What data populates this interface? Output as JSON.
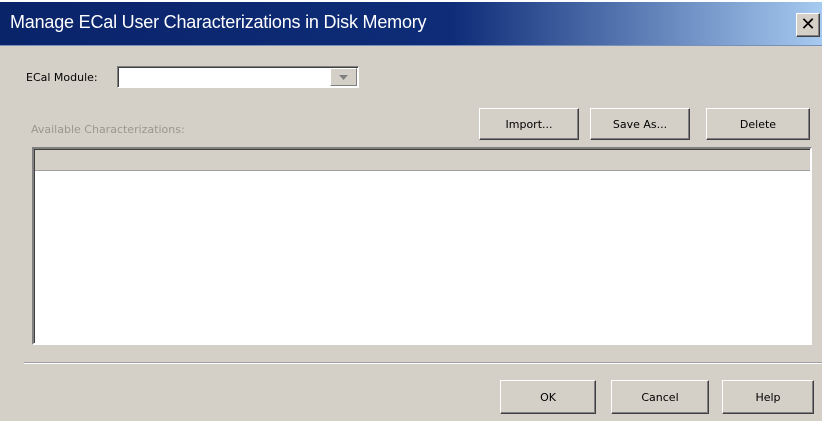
{
  "dialog": {
    "title": "Manage ECal User Characterizations in Disk Memory",
    "close_glyph": "✕"
  },
  "module": {
    "label": "ECal Module:",
    "selected": ""
  },
  "characterizations": {
    "label": "Available Characterizations:",
    "items": []
  },
  "actions": {
    "import": "Import...",
    "save_as": "Save As...",
    "delete": "Delete"
  },
  "footer": {
    "ok": "OK",
    "cancel": "Cancel",
    "help": "Help"
  },
  "icons": {
    "close": "close-icon",
    "dropdown": "chevron-down-icon"
  },
  "colors": {
    "titlebar": "#0a246a",
    "dialog_bg": "#d4d0c8"
  }
}
